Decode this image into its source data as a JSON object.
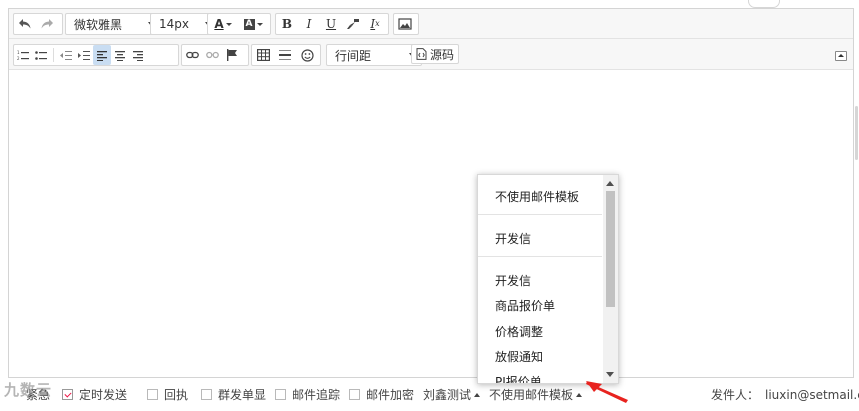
{
  "toolbar": {
    "font_family": "微软雅黑",
    "font_size": "14px",
    "line_height_label": "行间距",
    "source_label": "源码",
    "color_font": "A",
    "bold": "B",
    "italic": "I",
    "underline": "U",
    "clear_format": "I",
    "clear_format_sub": "x",
    "accent_color": "#c9ddf2"
  },
  "dropdown": {
    "items": [
      "不使用邮件模板",
      "开发信",
      "开发信",
      "商品报价单",
      "价格调整",
      "放假通知",
      "PI报价单"
    ]
  },
  "bottom": {
    "watermark": "九数云",
    "label_separate": "紧急",
    "label_send": "定时发送",
    "label_receipt": "回执",
    "label_group": "群发单显",
    "label_track": "邮件追踪",
    "label_encrypt": "邮件加密",
    "template_account": "刘鑫测试",
    "template_select": "不使用邮件模板",
    "sender_label": "发件人：",
    "sender_email": "liuxin@setmail.cn",
    "annotation_color": "#e8231f"
  }
}
